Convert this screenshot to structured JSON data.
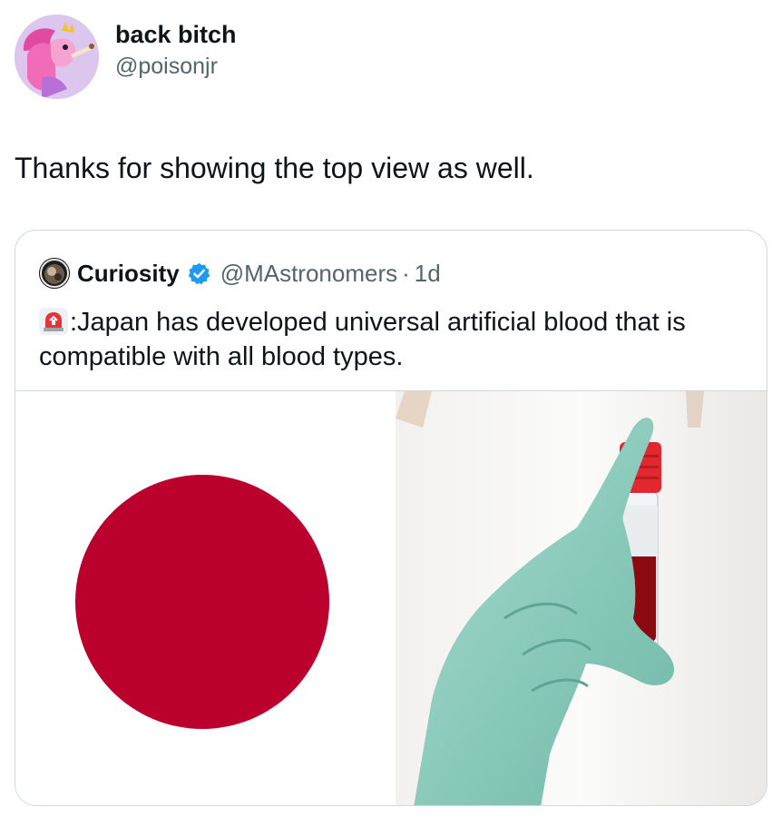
{
  "author": {
    "display_name": "back bitch",
    "handle": "@poisonjr",
    "avatar_icon": "cartoon-avatar-icon"
  },
  "post": {
    "text": "Thanks for showing the top view as well."
  },
  "quote": {
    "display_name": "Curiosity",
    "handle": "@MAstronomers",
    "separator": "·",
    "time": "1d",
    "verified_icon": "verified-badge-icon",
    "verified_color": "#1d9bf0",
    "text_prefix_icon": "siren-icon",
    "text": ":Japan has developed universal artificial blood that is compatible with all blood types.",
    "media": [
      {
        "icon": "japan-flag-image",
        "circle_color": "#bc002d"
      },
      {
        "icon": "blood-vial-glove-photo",
        "glove_color": "#8ecfc0",
        "cap_color": "#e0282e",
        "blood_color": "#8b0a12"
      }
    ]
  }
}
